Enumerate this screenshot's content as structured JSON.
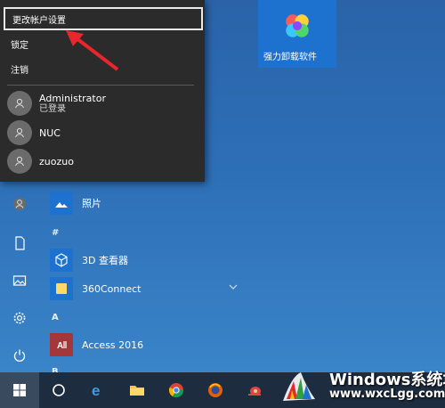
{
  "popup": {
    "items": [
      {
        "label": "更改帐户设置"
      },
      {
        "label": "锁定"
      },
      {
        "label": "注销"
      }
    ],
    "accounts": [
      {
        "name": "Administrator",
        "status": "已登录"
      },
      {
        "name": "NUC",
        "status": ""
      },
      {
        "name": "zuozuo",
        "status": ""
      }
    ]
  },
  "tiles": {
    "big": {
      "label": "强力卸载软件"
    }
  },
  "apps": {
    "photos": "照片",
    "section_hash": "#",
    "viewer3d": "3D 查看器",
    "connect360": "360Connect",
    "section_a": "A",
    "access": "Access 2016",
    "section_b": "B"
  },
  "watermark": {
    "title": "Windows系统城",
    "url": "www.wxcLgg.com"
  },
  "colors": {
    "accent": "#1d72cf",
    "access_red": "#a4373a",
    "popup_bg": "#2b2b2b"
  }
}
